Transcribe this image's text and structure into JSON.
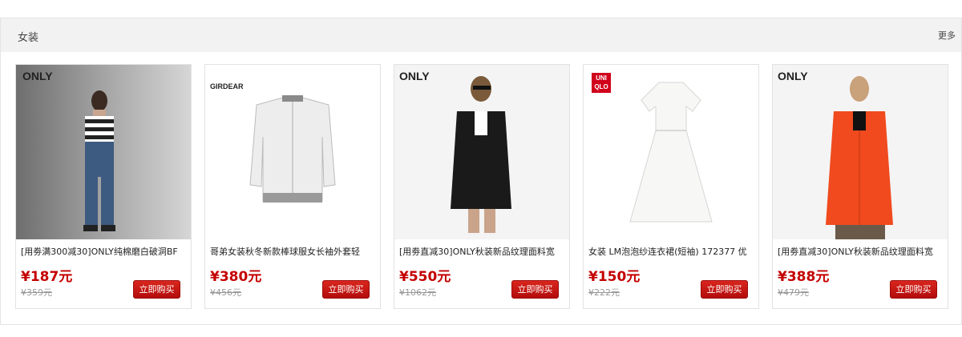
{
  "section": {
    "title": "女装",
    "more_label": "更多"
  },
  "products": [
    {
      "name": "[用劵满300减30]ONLY纯棉磨白破洞BF",
      "price": "¥187元",
      "old_price": "¥359元",
      "buy_label": "立即购买",
      "brand": "ONLY"
    },
    {
      "name": "哥弟女装秋冬新款棒球服女长袖外套轻",
      "price": "¥380元",
      "old_price": "¥456元",
      "buy_label": "立即购买",
      "brand": "GIRDEAR"
    },
    {
      "name": "[用劵直减30]ONLY秋装新品纹理面料宽",
      "price": "¥550元",
      "old_price": "¥1062元",
      "buy_label": "立即购买",
      "brand": "ONLY"
    },
    {
      "name": "女装 LM泡泡纱连衣裙(短袖) 172377 优",
      "price": "¥150元",
      "old_price": "¥222元",
      "buy_label": "立即购买",
      "brand": "UNI QLO"
    },
    {
      "name": "[用劵直减30]ONLY秋装新品纹理面料宽",
      "price": "¥388元",
      "old_price": "¥479元",
      "buy_label": "立即购买",
      "brand": "ONLY"
    }
  ],
  "colors": {
    "price": "#c40000",
    "buy_button": "#c8181b",
    "header_bg": "#f2f2f2"
  }
}
